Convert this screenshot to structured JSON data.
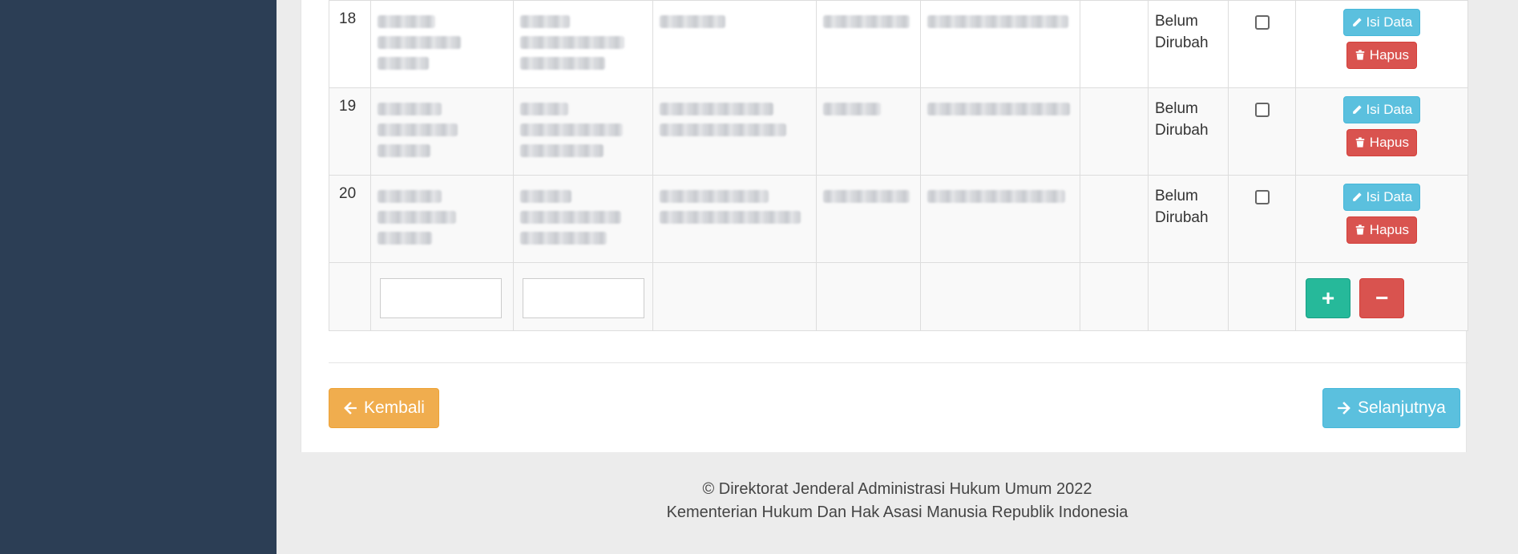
{
  "rows": [
    {
      "no": "18",
      "status_line1": "Belum",
      "status_line2": "Dirubah",
      "edit_label": "Isi Data",
      "delete_label": "Hapus"
    },
    {
      "no": "19",
      "status_line1": "Belum",
      "status_line2": "Dirubah",
      "edit_label": "Isi Data",
      "delete_label": "Hapus"
    },
    {
      "no": "20",
      "status_line1": "Belum",
      "status_line2": "Dirubah",
      "edit_label": "Isi Data",
      "delete_label": "Hapus"
    }
  ],
  "input_row": {
    "add_label": "+",
    "remove_label": "−"
  },
  "nav": {
    "back_label": "Kembali",
    "next_label": "Selanjutnya"
  },
  "footer": {
    "line1": "© Direktorat Jenderal Administrasi Hukum Umum 2022",
    "line2": "Kementerian Hukum Dan Hak Asasi Manusia Republik Indonesia"
  },
  "colors": {
    "sidebar": "#2c3e55",
    "info": "#5bc0de",
    "danger": "#d9534f",
    "success": "#26b99a",
    "warning": "#f0ad4e"
  },
  "icons": {
    "edit": "pencil-icon",
    "delete": "trash-icon",
    "back": "arrow-left-icon",
    "next": "arrow-right-icon"
  }
}
